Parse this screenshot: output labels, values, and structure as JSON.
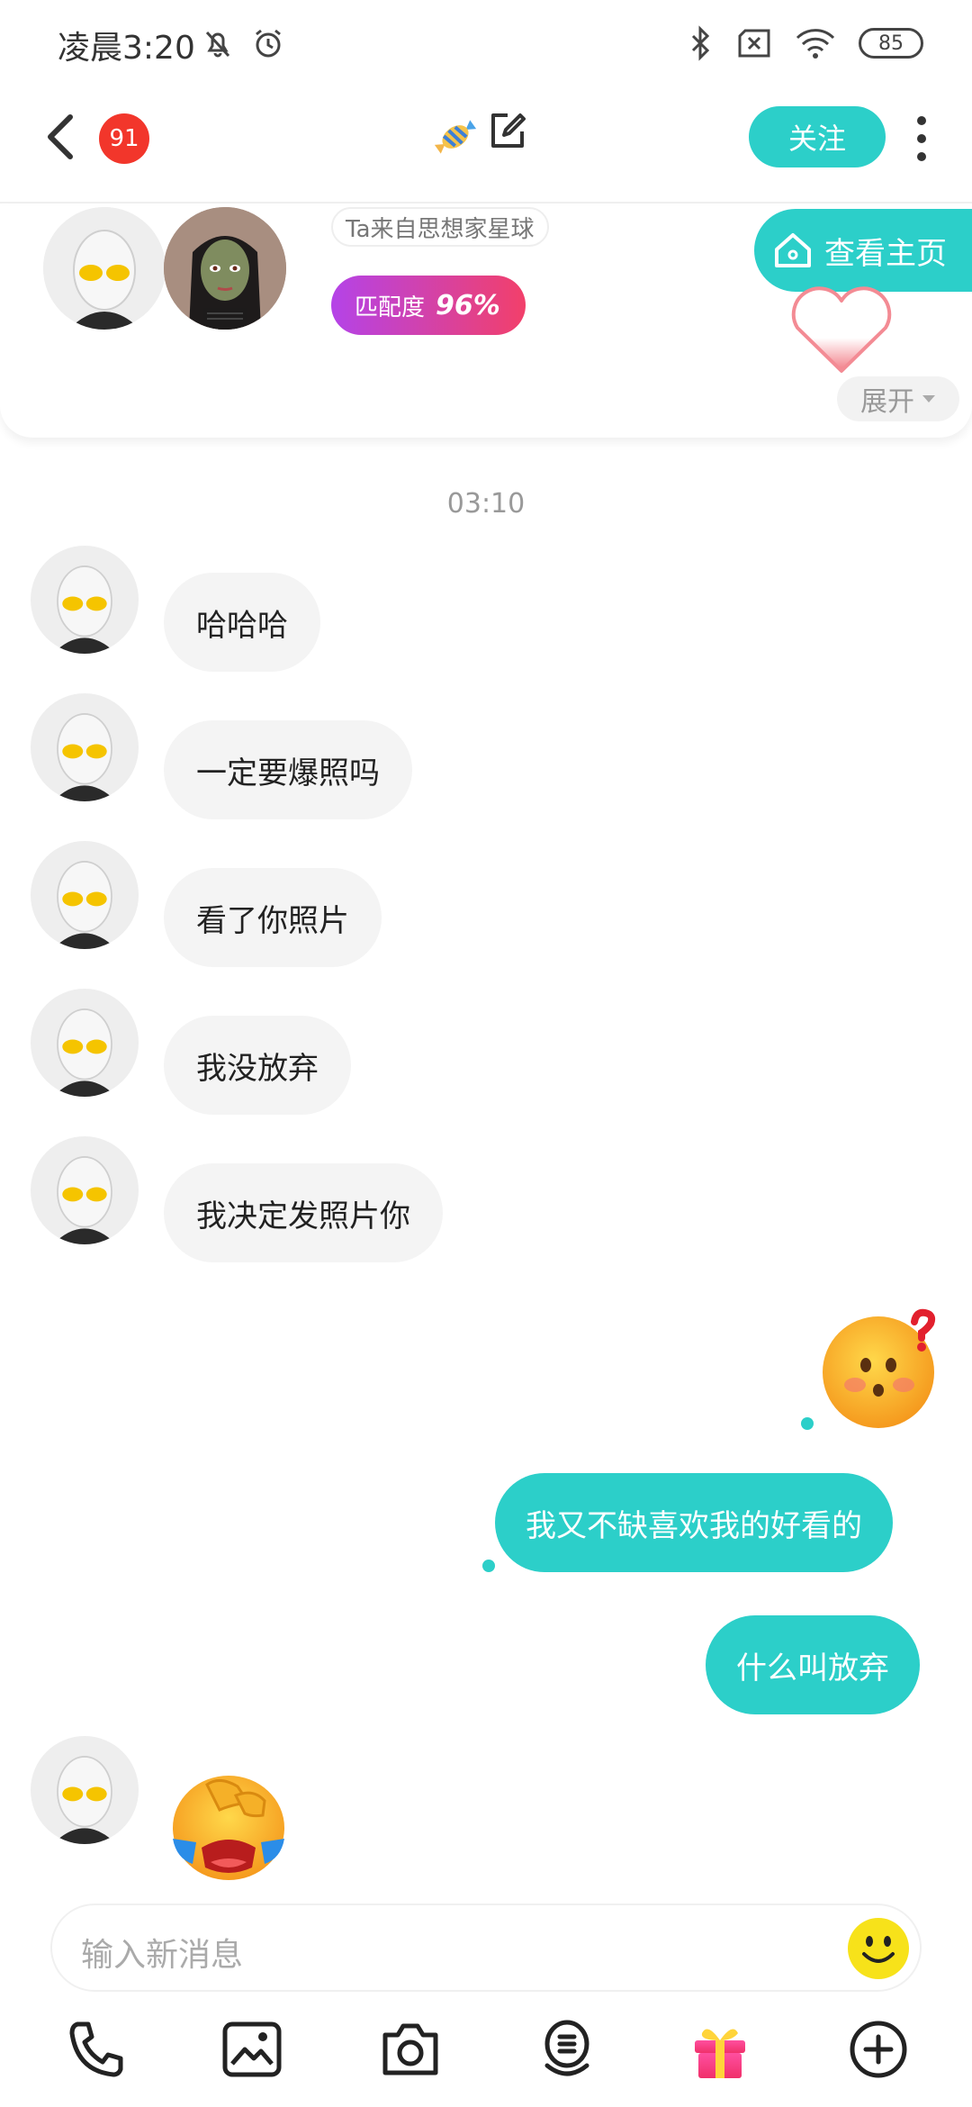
{
  "status_bar": {
    "time": "凌晨3:20",
    "battery": "85"
  },
  "header": {
    "unread_count": "91",
    "follow_label": "关注"
  },
  "profile": {
    "origin": "Ta来自思想家星球",
    "match_label": "匹配度",
    "match_value": "96%",
    "homepage_label": "查看主页",
    "expand_label": "展开"
  },
  "chat": {
    "timestamp": "03:10",
    "incoming": [
      "哈哈哈",
      "一定要爆照吗",
      "看了你照片",
      "我没放弃",
      "我决定发照片你"
    ],
    "outgoing": [
      "我又不缺喜欢我的好看的",
      "什么叫放弃"
    ]
  },
  "input": {
    "placeholder": "输入新消息"
  },
  "colors": {
    "accent": "#2ccfc9",
    "badge": "#f2362b",
    "bubble_in": "#f4f4f4"
  }
}
